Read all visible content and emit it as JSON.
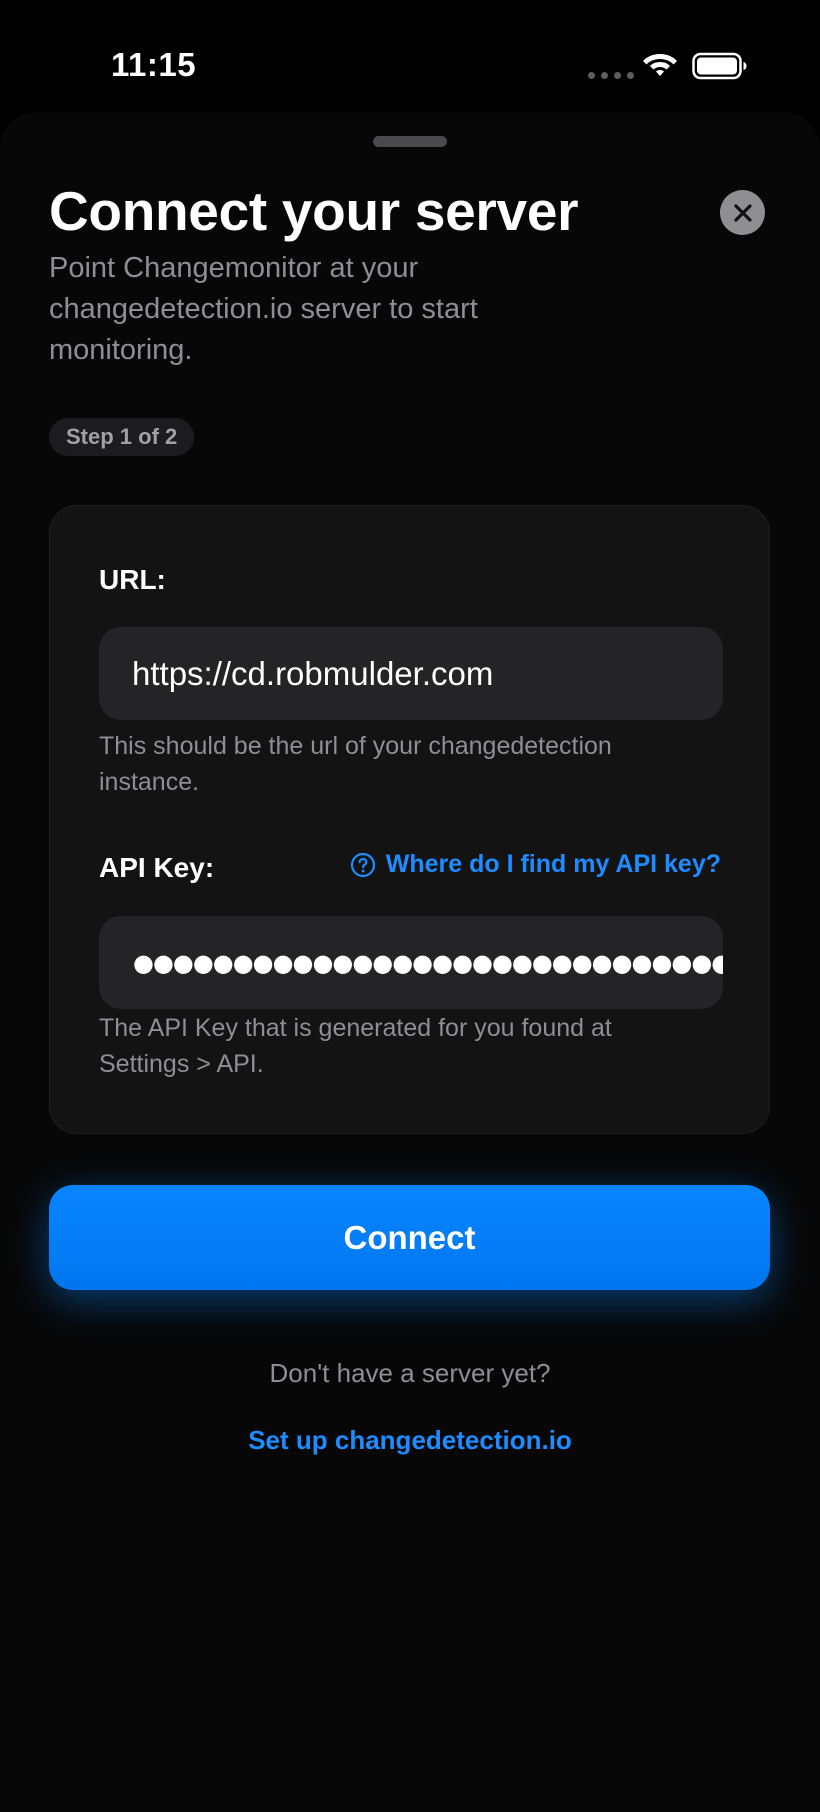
{
  "status_bar": {
    "time": "11:15",
    "icons": [
      "cellular-signal-icon",
      "wifi-icon",
      "battery-icon"
    ]
  },
  "sheet": {
    "title": "Connect your server",
    "subtitle": "Point Changemonitor at your changedetection.io server to start monitoring.",
    "step_badge": "Step 1 of 2",
    "close_icon": "close-icon"
  },
  "form": {
    "url": {
      "label": "URL:",
      "value": "https://cd.robmulder.com",
      "hint": "This should be the url of your changedetection instance."
    },
    "api_key": {
      "label": "API Key:",
      "masked_value": "●●●●●●●●●●●●●●●●●●●●●●●●●●●●●●…",
      "help_link": "Where do I find my API key?",
      "help_icon": "question-circle-icon",
      "hint": "The API Key that is generated for you found at Settings > API."
    }
  },
  "actions": {
    "connect_label": "Connect",
    "no_server_text": "Don't have a server yet?",
    "setup_link": "Set up changedetection.io"
  },
  "colors": {
    "background": "#000000",
    "accent": "#0A84FF",
    "secondary_text": "#8E8E93",
    "input_background": "#242426"
  }
}
